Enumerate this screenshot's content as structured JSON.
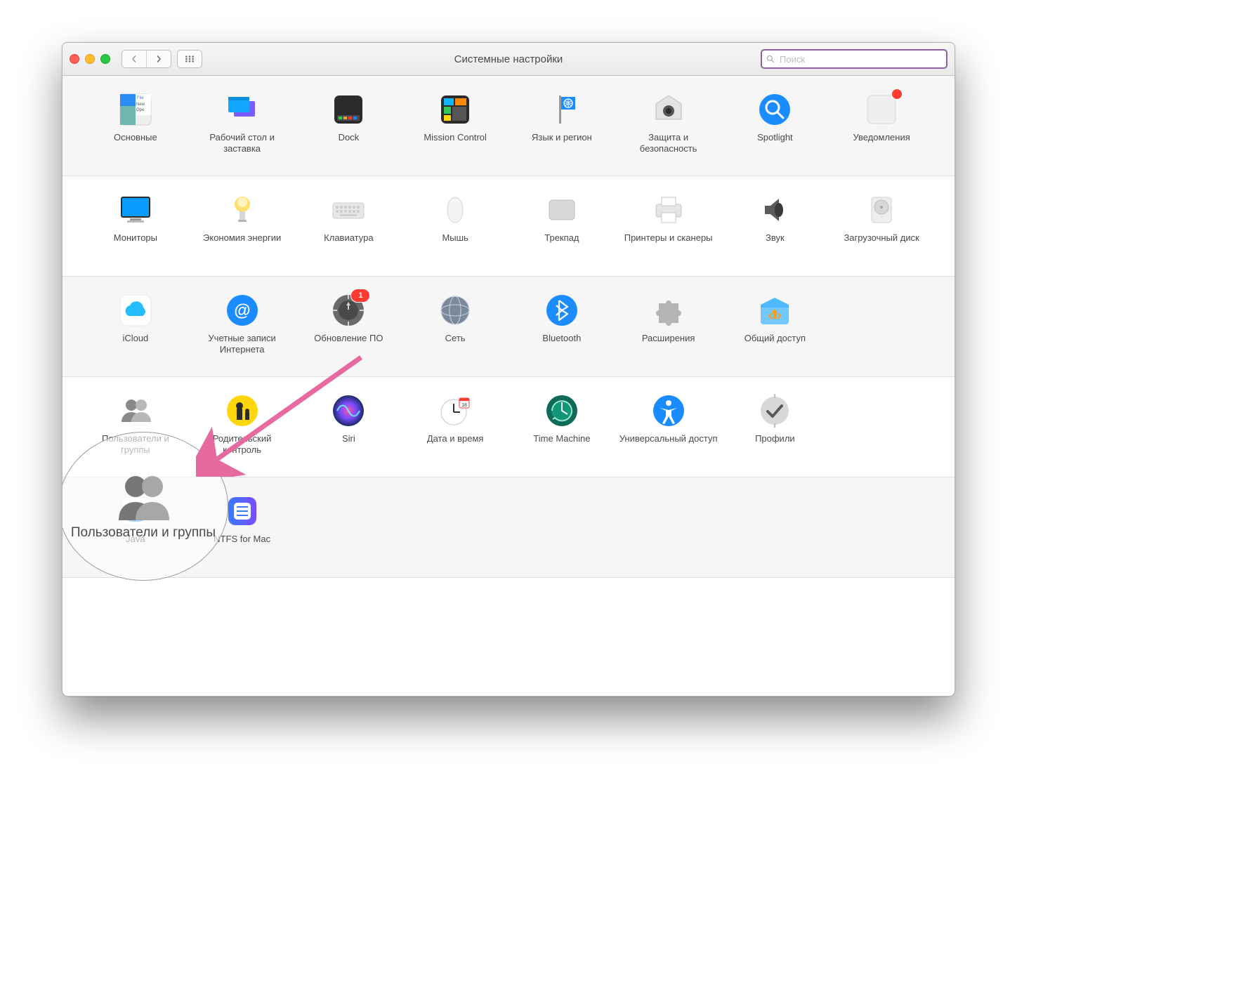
{
  "window": {
    "title": "Системные настройки"
  },
  "search": {
    "placeholder": "Поиск"
  },
  "callout": {
    "label": "Пользователи и группы"
  },
  "rows": [
    [
      {
        "key": "general",
        "label": "Основные"
      },
      {
        "key": "desktop",
        "label": "Рабочий стол и заставка"
      },
      {
        "key": "dock",
        "label": "Dock"
      },
      {
        "key": "mission",
        "label": "Mission Control"
      },
      {
        "key": "lang",
        "label": "Язык и регион"
      },
      {
        "key": "security",
        "label": "Защита и безопасность"
      },
      {
        "key": "spotlight",
        "label": "Spotlight"
      },
      {
        "key": "notifications",
        "label": "Уведомления"
      }
    ],
    [
      {
        "key": "displays",
        "label": "Мониторы"
      },
      {
        "key": "energy",
        "label": "Экономия энергии"
      },
      {
        "key": "keyboard",
        "label": "Клавиатура"
      },
      {
        "key": "mouse",
        "label": "Мышь"
      },
      {
        "key": "trackpad",
        "label": "Трекпад"
      },
      {
        "key": "printers",
        "label": "Принтеры и сканеры"
      },
      {
        "key": "sound",
        "label": "Звук"
      },
      {
        "key": "startup",
        "label": "Загрузочный диск"
      }
    ],
    [
      {
        "key": "icloud",
        "label": "iCloud"
      },
      {
        "key": "internet",
        "label": "Учетные записи Интернета"
      },
      {
        "key": "swupdate",
        "label": "Обновление ПО",
        "badge": "1"
      },
      {
        "key": "network",
        "label": "Сеть"
      },
      {
        "key": "bluetooth",
        "label": "Bluetooth"
      },
      {
        "key": "extensions",
        "label": "Расширения"
      },
      {
        "key": "sharing",
        "label": "Общий доступ"
      }
    ],
    [
      {
        "key": "users",
        "label": "Пользователи и группы"
      },
      {
        "key": "parental",
        "label": "Родительский контроль"
      },
      {
        "key": "siri",
        "label": "Siri"
      },
      {
        "key": "datetime",
        "label": "Дата и время"
      },
      {
        "key": "timemachine",
        "label": "Time Machine"
      },
      {
        "key": "accessibility",
        "label": "Универсальный доступ"
      },
      {
        "key": "profiles",
        "label": "Профили"
      }
    ],
    [
      {
        "key": "java",
        "label": "Java"
      },
      {
        "key": "ntfs",
        "label": "NTFS for Mac"
      }
    ]
  ]
}
